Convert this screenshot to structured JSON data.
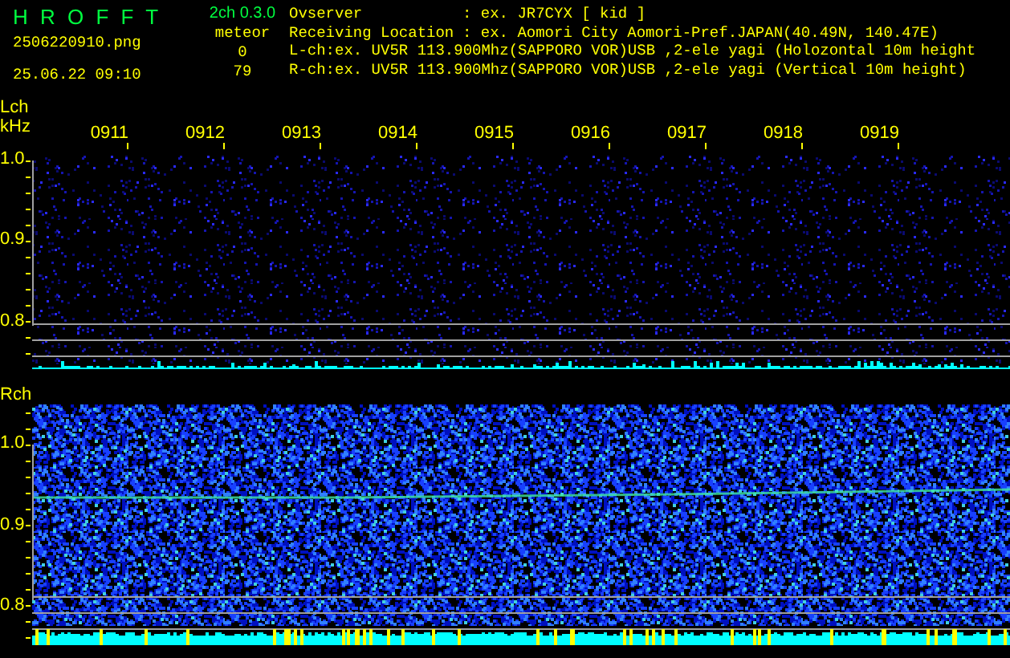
{
  "header": {
    "title": "H R O F F T",
    "file": "2506220910.png",
    "datetime": "25.06.22 09:10",
    "version": "2ch 0.3.0",
    "counter_label": "meteor",
    "counts": [
      "0",
      "79"
    ],
    "info": [
      {
        "label": "Ovserver",
        "value": ": ex. JR7CYX [ kid ]"
      },
      {
        "label": "Receiving Location",
        "value": ": ex. Aomori City Aomori-Pref.JAPAN(40.49N, 140.47E)"
      }
    ],
    "channel_lines": [
      "L-ch:ex. UV5R 113.900Mhz(SAPPORO VOR)USB ,2-ele yagi (Holozontal 10m height",
      "R-ch:ex. UV5R 113.900Mhz(SAPPORO VOR)USB ,2-ele yagi (Vertical 10m height)"
    ]
  },
  "time_labels": [
    "0911",
    "0912",
    "0913",
    "0914",
    "0915",
    "0916",
    "0917",
    "0918",
    "0919"
  ],
  "panels": [
    {
      "channel": "Lch",
      "unit": "kHz",
      "y_labels": [
        "1.0",
        "0.9",
        "0.8"
      ]
    },
    {
      "channel": "Rch",
      "y_labels": [
        "1.0",
        "0.9",
        "0.8"
      ]
    }
  ]
}
